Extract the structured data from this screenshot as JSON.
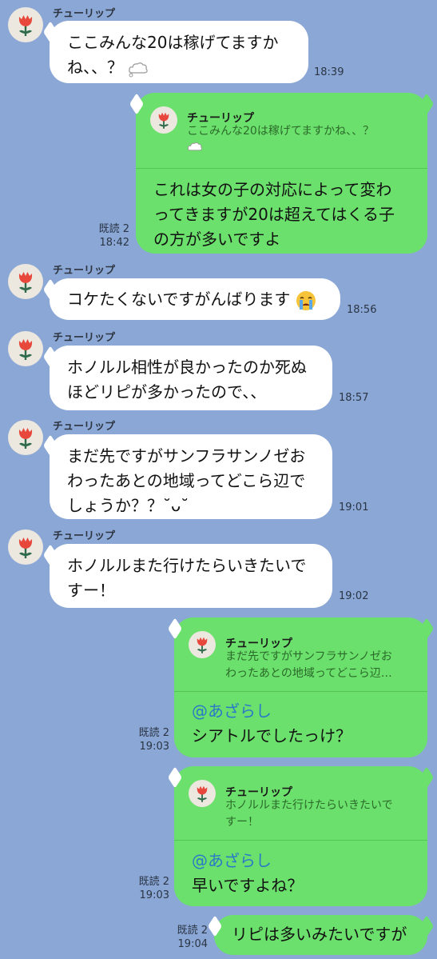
{
  "colors": {
    "background": "#8aa7d6",
    "incoming_bubble": "#ffffff",
    "outgoing_bubble": "#6ce06c",
    "mention": "#2a78c8"
  },
  "icons": {
    "avatar": "tulip-icon",
    "cloud": "cloud-emoji-icon",
    "crying": "crying-face-emoji-icon"
  },
  "messages": [
    {
      "sender": "チューリップ",
      "lines": [
        "ここみんな20は稼げてますか",
        "ね、、？"
      ],
      "time": "18:39"
    },
    {
      "quote_name": "チューリップ",
      "quote_lines": [
        "ここみんな20は稼げてますかね、、？"
      ],
      "lines": [
        "これは女の子の対応によって変わ",
        "ってきますが20は超えてはくる子",
        "の方が多いですよ"
      ],
      "read": "既読 2",
      "time": "18:42"
    },
    {
      "sender": "チューリップ",
      "lines": [
        "コケたくないですがんばります"
      ],
      "time": "18:56"
    },
    {
      "sender": "チューリップ",
      "lines": [
        "ホノルル相性が良かったのか死ぬ",
        "ほどリピが多かったので、、"
      ],
      "time": "18:57"
    },
    {
      "sender": "チューリップ",
      "lines": [
        "まだ先ですがサンフラサンノゼお",
        "わったあとの地域ってどこら辺で",
        "しょうか？？˘ᴗ˘"
      ],
      "time": "19:01"
    },
    {
      "sender": "チューリップ",
      "lines": [
        "ホノルルまた行けたらいきたいで",
        "すー！"
      ],
      "time": "19:02"
    },
    {
      "quote_name": "チューリップ",
      "quote_lines": [
        "まだ先ですがサンフラサンノゼお",
        "わったあとの地域ってどこら辺…"
      ],
      "mention": "@あざらし",
      "lines": [
        "シアトルでしたっけ？"
      ],
      "read": "既読 2",
      "time": "19:03"
    },
    {
      "quote_name": "チューリップ",
      "quote_lines": [
        "ホノルルまた行けたらいきたいで",
        "すー！"
      ],
      "mention": "@あざらし",
      "lines": [
        "早いですよね？"
      ],
      "read": "既読 2",
      "time": "19:03"
    },
    {
      "lines": [
        "リピは多いみたいですが"
      ],
      "read": "既読 2",
      "time": "19:04"
    }
  ]
}
